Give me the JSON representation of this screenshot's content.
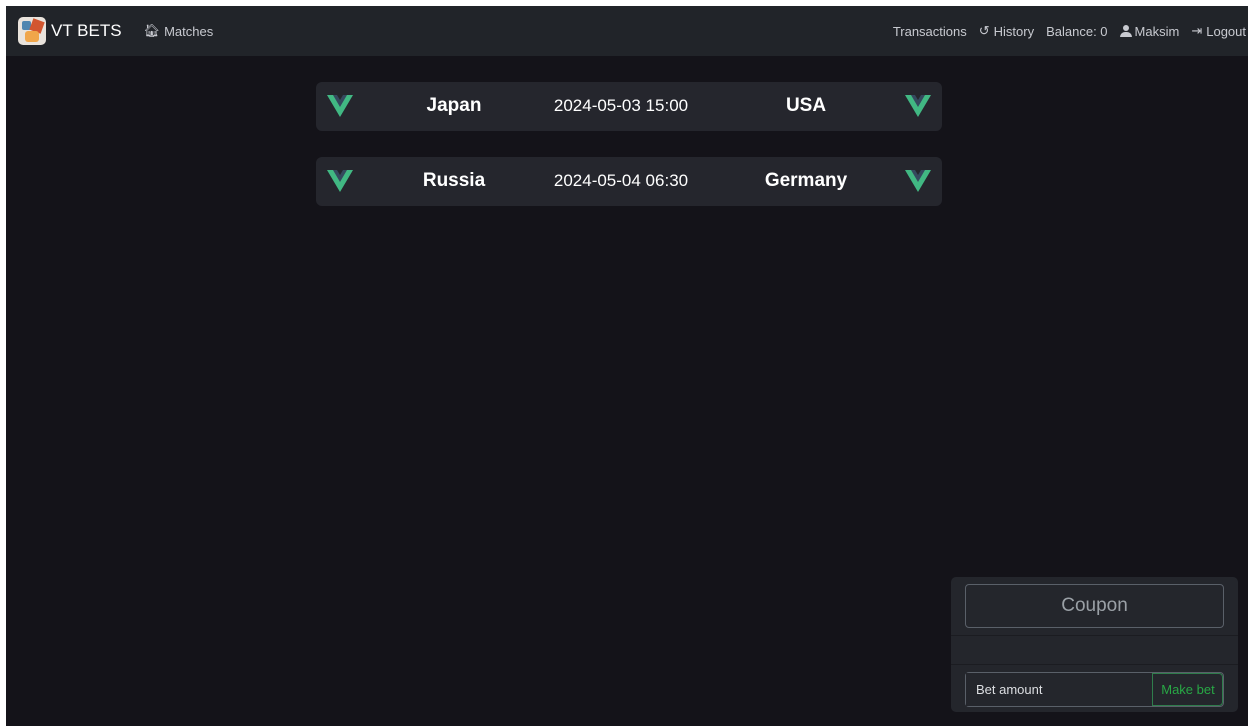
{
  "navbar": {
    "brand": "VT BETS",
    "matches_label": "Matches",
    "transactions_label": "Transactions",
    "history_label": "History",
    "balance_label": "Balance: 0",
    "user_name": "Maksim",
    "logout_label": "Logout"
  },
  "matches": [
    {
      "team1": "Japan",
      "datetime": "2024-05-03 15:00",
      "team2": "USA"
    },
    {
      "team1": "Russia",
      "datetime": "2024-05-04 06:30",
      "team2": "Germany"
    }
  ],
  "coupon": {
    "title": "Coupon",
    "bet_placeholder": "Bet amount",
    "make_bet_label": "Make bet"
  },
  "colors": {
    "background": "#141319",
    "navbar": "#212429",
    "card": "#25262d",
    "vue_green": "#41b883",
    "vue_dark": "#35495e",
    "success": "#28a745"
  },
  "icons": [
    "home-icon",
    "history-icon",
    "user-icon",
    "logout-icon",
    "vue-logo-icon"
  ]
}
